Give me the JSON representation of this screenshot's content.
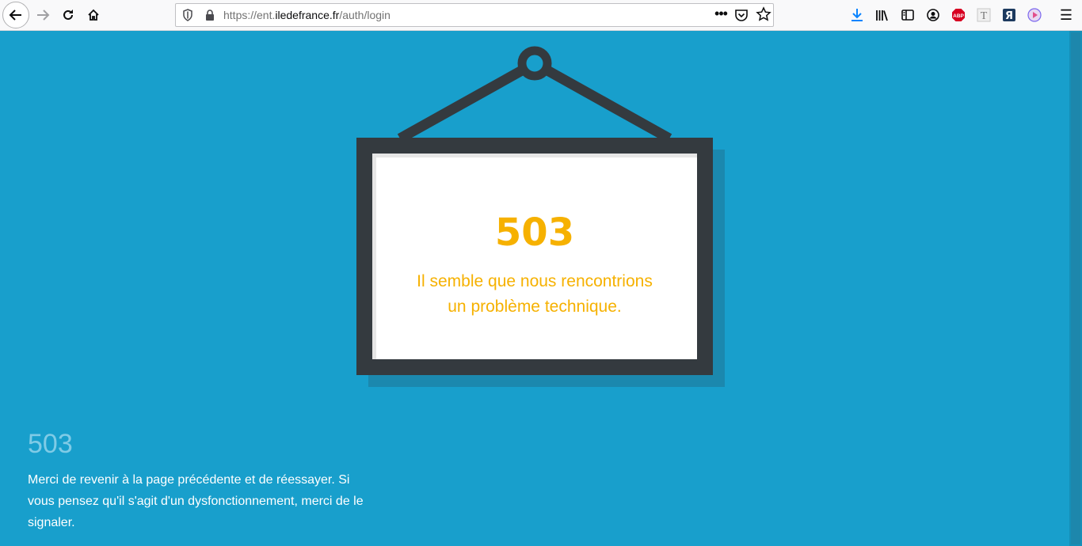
{
  "browser": {
    "url_prefix": "https://ent.",
    "url_domain": "iledefrance.fr",
    "url_path": "/auth/login",
    "more_label": "•••",
    "abp_label": "ABP",
    "t_label": "T",
    "ya_label": "Я",
    "menu_label": "☰"
  },
  "sign": {
    "code": "503",
    "message_line1": "Il semble que nous rencontrions",
    "message_line2": "un problème technique."
  },
  "footer": {
    "code": "503",
    "message": "Merci de revenir à la page précédente et de réessayer. Si vous pensez qu'il s'agit d'un dysfonctionnement, merci de le signaler."
  },
  "colors": {
    "background": "#189fcc",
    "frame": "#343a3f",
    "accent": "#f6b100",
    "footer_code": "#7fcbe6"
  },
  "icons": [
    "back-arrow-icon",
    "forward-arrow-icon",
    "reload-icon",
    "home-icon",
    "shield-icon",
    "lock-icon",
    "more-icon",
    "pocket-icon",
    "star-icon",
    "download-icon",
    "library-icon",
    "sidebar-icon",
    "account-icon",
    "adblock-icon",
    "translate-icon",
    "yandex-icon",
    "player-icon",
    "menu-icon"
  ]
}
